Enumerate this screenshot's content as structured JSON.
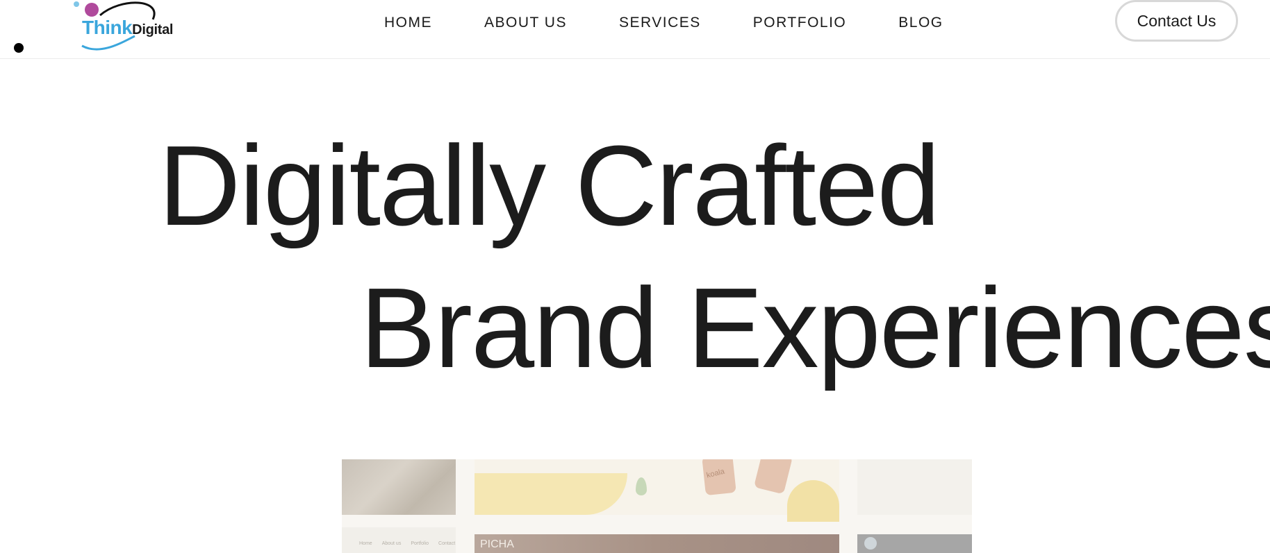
{
  "brand": {
    "name_part1": "Think",
    "name_part2": "Digital"
  },
  "nav": {
    "items": [
      {
        "label": "HOME"
      },
      {
        "label": "ABOUT US"
      },
      {
        "label": "SERVICES"
      },
      {
        "label": "PORTFOLIO"
      },
      {
        "label": "BLOG"
      }
    ],
    "cta_label": "Contact Us"
  },
  "hero": {
    "line1": "Digitally Crafted",
    "line2": "Brand Experiences"
  },
  "preview": {
    "mini_nav": [
      "Home",
      "About us",
      "Portfolio",
      "Contact"
    ],
    "bottle_label": "koala",
    "dark_bar_logo": "PICHA"
  },
  "colors": {
    "logo_blue": "#3aa6dc",
    "logo_purple": "#b04a9c",
    "text": "#1c1c1c",
    "button_border": "#d8d8d8"
  }
}
